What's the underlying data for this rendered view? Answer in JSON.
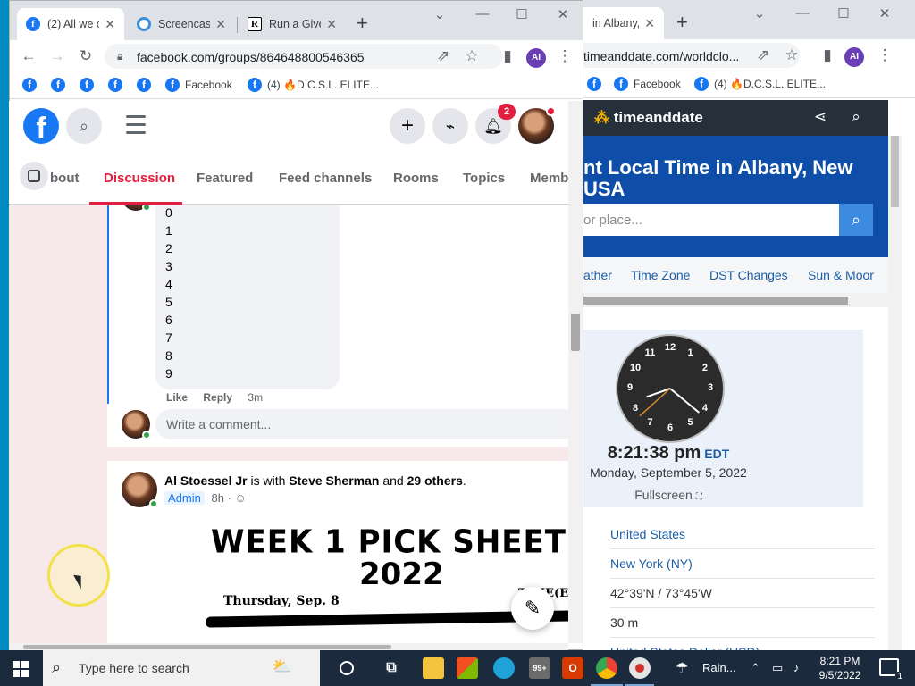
{
  "fb_window": {
    "tabs": [
      {
        "title": "(2) All we c",
        "favicon": "facebook-icon"
      },
      {
        "title": "Screencast",
        "favicon": "screencast-icon"
      },
      {
        "title": "Run a Give",
        "favicon": "r-icon"
      }
    ],
    "url": "facebook.com/groups/864648800546365",
    "account_initials": "AI",
    "bookmarks": [
      "Facebook",
      "(4) 🔥D.C.S.L. ELITE..."
    ]
  },
  "facebook": {
    "notification_count": "2",
    "nav": {
      "items": [
        "bout",
        "Discussion",
        "Featured",
        "Feed channels",
        "Rooms",
        "Topics",
        "Memb"
      ],
      "active": "Discussion"
    },
    "comment": {
      "lines": [
        "0",
        "1",
        "2",
        "3",
        "4",
        "5",
        "6",
        "7",
        "8",
        "9"
      ],
      "like": "Like",
      "reply": "Reply",
      "time": "3m"
    },
    "write_comment_placeholder": "Write a comment...",
    "post": {
      "author": "Al Stoessel Jr",
      "is_with": "is with",
      "tagged": "Steve Sherman",
      "and": "and",
      "others": "29 others",
      "badge": "Admin",
      "time": "8h",
      "image_lines": [
        "WEEK 1 PICK SHEET",
        "2022",
        "Thursday, Sep. 8",
        "TIME(ET"
      ]
    }
  },
  "tad_window": {
    "tab_title": "in Albany,",
    "url": "timeanddate.com/worldclo...",
    "account_initials": "AI",
    "bookmarks": [
      "Facebook",
      "(4) 🔥D.C.S.L. ELITE..."
    ]
  },
  "timeanddate": {
    "logo": "timeanddate",
    "title": "nt Local Time in Albany, New USA",
    "search_placeholder": "or place...",
    "tabs": [
      "ather",
      "Time Zone",
      "DST Changes",
      "Sun & Moor"
    ],
    "clock": {
      "hour": 8,
      "minute": 21,
      "second": 38,
      "numbers": [
        "12",
        "1",
        "2",
        "3",
        "4",
        "5",
        "6",
        "7",
        "8",
        "9",
        "10",
        "11"
      ]
    },
    "time": "8:21:38 pm",
    "tz": "EDT",
    "date": "Monday, September 5, 2022",
    "fullscreen": "Fullscreen",
    "rows": [
      "United States",
      "New York (NY)",
      "42°39'N / 73°45'W",
      "30 m",
      "United States Dollar (USD)"
    ]
  },
  "taskbar": {
    "search_placeholder": "Type here to search",
    "badge": "99+",
    "weather": "Rain...",
    "time": "8:21 PM",
    "date": "9/5/2022",
    "notification_count": "1"
  },
  "colors": {
    "facebook_blue": "#1877f2",
    "active_tab": "#e41e3f",
    "tad_blue": "#0f4ea8",
    "taskbar": "#1b2b3d"
  }
}
